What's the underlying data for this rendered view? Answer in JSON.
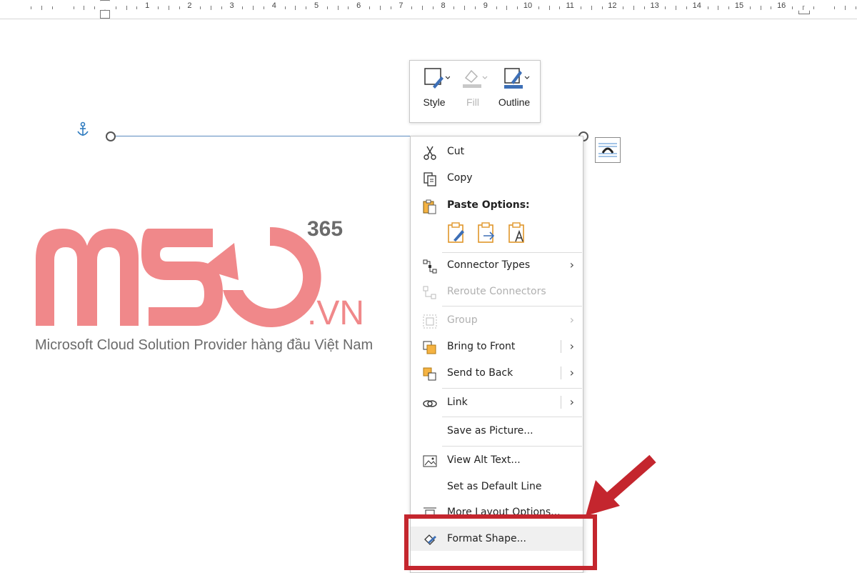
{
  "ruler": {
    "numbers": [
      "1",
      "2",
      "3",
      "4",
      "5",
      "6",
      "7",
      "8",
      "9",
      "10",
      "11",
      "12",
      "13",
      "14",
      "15",
      "16"
    ]
  },
  "mini_toolbar": {
    "style_label": "Style",
    "fill_label": "Fill",
    "outline_label": "Outline"
  },
  "logo": {
    "superscript": "365",
    "domain_suffix": ".VN",
    "tagline": "Microsoft Cloud Solution Provider hàng đầu Việt Nam",
    "brand_color": "#f0888a"
  },
  "context_menu": {
    "cut": "Cut",
    "copy": "Copy",
    "paste_options": "Paste Options:",
    "connector_types": "Connector Types",
    "reroute_connectors": "Reroute Connectors",
    "group": "Group",
    "bring_to_front": "Bring to Front",
    "send_to_back": "Send to Back",
    "link": "Link",
    "save_as_picture": "Save as Picture...",
    "view_alt_text": "View Alt Text...",
    "set_default_line": "Set as Default Line",
    "more_layout": "More Layout Options...",
    "format_shape": "Format Shape..."
  },
  "annotation": {
    "color": "#c4262e"
  }
}
